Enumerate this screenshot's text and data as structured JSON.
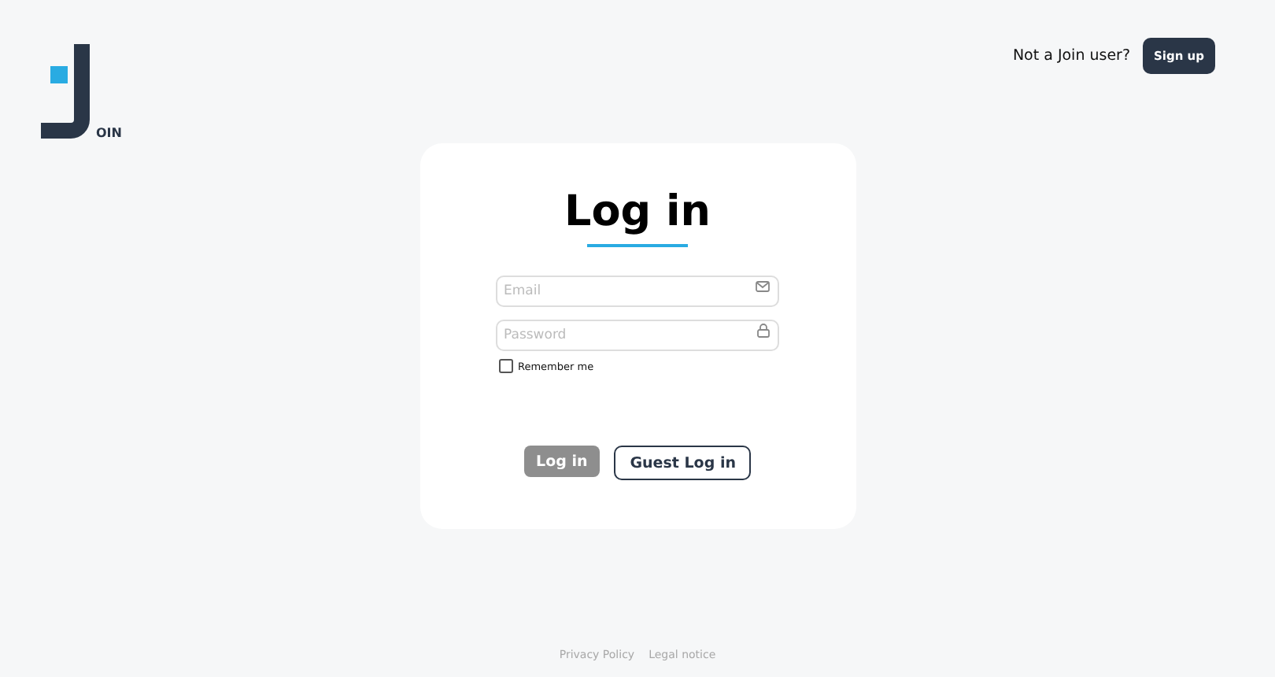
{
  "logo": {
    "text": "OIN"
  },
  "header": {
    "prompt": "Not a Join user?",
    "signup_button": "Sign up"
  },
  "login": {
    "title": "Log in",
    "fields": [
      {
        "kind": "email",
        "placeholder": "Email"
      },
      {
        "kind": "password",
        "placeholder": "Password"
      }
    ],
    "remember": {
      "label": "Remember me",
      "checked": false
    },
    "login_button": {
      "label": "Log in",
      "disabled": true
    },
    "guest_button": "Guest Log in"
  },
  "footer": [
    "Privacy Policy",
    "Legal notice"
  ]
}
